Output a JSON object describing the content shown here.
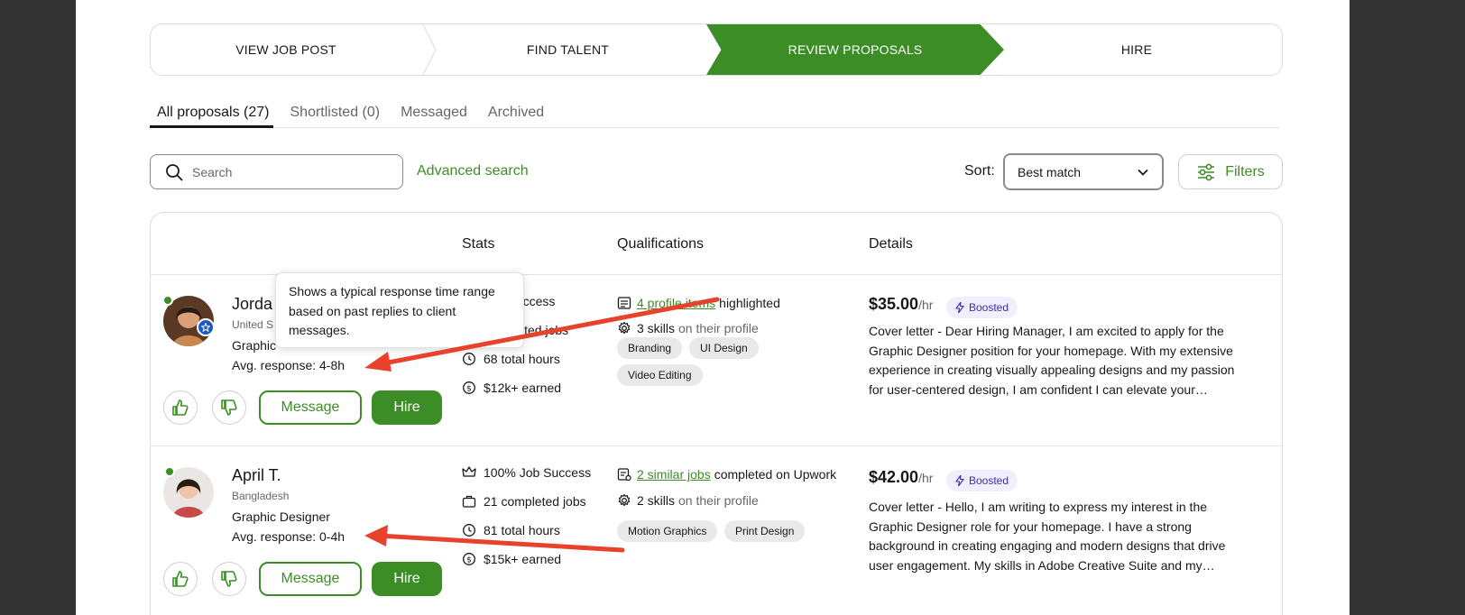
{
  "steps": [
    "VIEW JOB POST",
    "FIND TALENT",
    "REVIEW PROPOSALS",
    "HIRE"
  ],
  "tabs": [
    "All proposals (27)",
    "Shortlisted (0)",
    "Messaged",
    "Archived"
  ],
  "search": {
    "placeholder": "Search"
  },
  "advanced_search": "Advanced search",
  "sort": {
    "label": "Sort:",
    "value": "Best match"
  },
  "filters_label": "Filters",
  "table_headers": {
    "stats": "Stats",
    "qualifications": "Qualifications",
    "details": "Details"
  },
  "tooltip": "Shows a typical response time range based on past replies to client messages.",
  "freelancers": [
    {
      "name": "Jorda",
      "location": "United S",
      "role": "Graphic",
      "response": "Avg. response: 4-8h",
      "stats": [
        "Job Success",
        "completed jobs",
        "68 total hours",
        "$12k+ earned"
      ],
      "qual_link": "4 profile items",
      "qual_link_after": "highlighted",
      "skills_bold": "3 skills",
      "skills_rest": "on their profile",
      "chips": [
        "Branding",
        "UI Design",
        "Video Editing"
      ],
      "rate": "$35.00",
      "rate_unit": "/hr",
      "boosted": "Boosted",
      "cover": "Cover letter - Dear Hiring Manager, I am excited to apply for the Graphic Designer position for your homepage. With my extensive experience in creating visually appealing designs and my passion for user-centered design, I am confident I can elevate your homepage."
    },
    {
      "name": "April T.",
      "location": "Bangladesh",
      "role": "Graphic Designer",
      "response": "Avg. response: 0-4h",
      "stats": [
        "100% Job Success",
        "21 completed jobs",
        "81 total hours",
        "$15k+ earned"
      ],
      "qual_link": "2 similar jobs",
      "qual_link_after": "completed on Upwork",
      "skills_bold": "2 skills",
      "skills_rest": "on their profile",
      "chips": [
        "Motion Graphics",
        "Print Design"
      ],
      "rate": "$42.00",
      "rate_unit": "/hr",
      "boosted": "Boosted",
      "cover": "Cover letter - Hello, I am writing to express my interest in the Graphic Designer role for your homepage. I have a strong background in creating engaging and modern designs that drive user engagement. My skills in Adobe Creative Suite and my understanding of UX principles."
    }
  ],
  "button_labels": {
    "message": "Message",
    "hire": "Hire"
  },
  "colors": {
    "brand_green": "#3c8d26",
    "annotation_red": "#e8412c",
    "boosted_bg": "#f1efff"
  }
}
